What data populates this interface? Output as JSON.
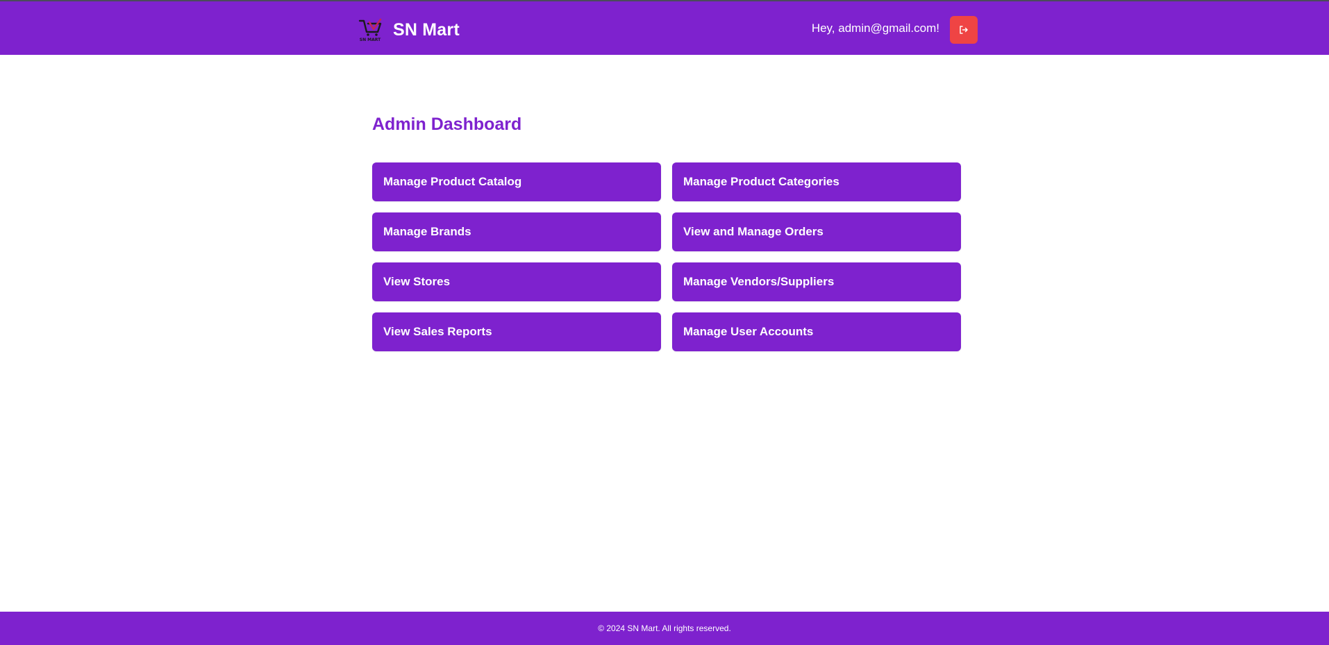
{
  "header": {
    "brand_name": "SN Mart",
    "logo_text": "SN MART",
    "greeting": "Hey, admin@gmail.com!",
    "logout_icon": "logout-icon"
  },
  "main": {
    "title": "Admin Dashboard",
    "tiles": [
      {
        "label": "Manage Product Catalog"
      },
      {
        "label": "Manage Product Categories"
      },
      {
        "label": "Manage Brands"
      },
      {
        "label": "View and Manage Orders"
      },
      {
        "label": "View Stores"
      },
      {
        "label": "Manage Vendors/Suppliers"
      },
      {
        "label": "View Sales Reports"
      },
      {
        "label": "Manage User Accounts"
      }
    ]
  },
  "footer": {
    "text": "© 2024 SN Mart. All rights reserved."
  },
  "colors": {
    "brand": "#7e22ce",
    "danger": "#ef4444",
    "background": "#ffffff"
  }
}
